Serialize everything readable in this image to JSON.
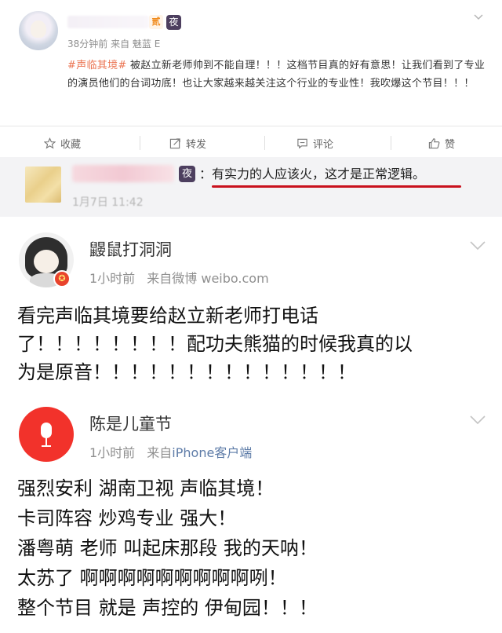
{
  "post": {
    "meta": "38分钟前  来自 魅蓝 E",
    "badge_level": "贰",
    "badge_ye": "夜",
    "topic": "#声临其境#",
    "body": " 被赵立新老师帅到不能自理！！！这档节目真的好有意思！让我们看到了专业的演员他们的台词功底！也让大家越来越关注这个行业的专业性！我吹爆这个节目！！！"
  },
  "actions": {
    "favorite": "收藏",
    "repost": "转发",
    "comment": "评论",
    "like": "赞"
  },
  "reply": {
    "badge": "夜",
    "text": "：有实力的人应该火，这才是正常逻辑。",
    "date": "1月7日 11:42"
  },
  "comments": [
    {
      "name": "鼹鼠打洞洞",
      "time": "1小时前",
      "source_prefix": "来自微博 ",
      "source": "weibo.com",
      "vip": "✪",
      "lines": [
        "看完声临其境要给赵立新老师打电话",
        "了！！！！！！！！配功夫熊猫的时候我真的以",
        "为是原音！！！！！！！！！！！！！！"
      ]
    },
    {
      "name": "陈是儿童节",
      "time": "1小时前",
      "source_prefix": "来自",
      "source": "iPhone客户端",
      "lines": [
        "强烈安利 湖南卫视 声临其境！",
        "卡司阵容 炒鸡专业 强大！",
        "潘粤萌 老师 叫起床那段 我的天呐！",
        "太苏了 啊啊啊啊啊啊啊啊啊咧！",
        "整个节目 就是 声控的 伊甸园！！！"
      ]
    }
  ],
  "colors": {
    "topic": "#eb7350",
    "underline": "#c9111d",
    "link": "#5d7ba7",
    "avatar_red": "#f2322b"
  }
}
